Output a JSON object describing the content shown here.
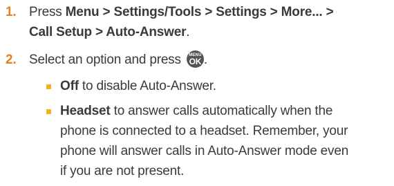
{
  "steps": [
    {
      "number": "1.",
      "line1_bold": "Menu > Settings/Tools > Settings > More... >",
      "line1_prefix": "Press ",
      "line2_bold": "Call Setup > Auto-Answer",
      "line2_suffix": "."
    },
    {
      "number": "2.",
      "text": "Select an option and press ",
      "key_icon": "menu-ok-key-icon",
      "key_label_top": "MENU",
      "key_label_bottom": "OK",
      "suffix": "."
    }
  ],
  "options": [
    {
      "bold": "Off",
      "lines": [
        " to disable Auto-Answer."
      ]
    },
    {
      "bold": "Headset",
      "lines": [
        " to answer calls automatically when the",
        "phone is connected to a headset. Remember, your",
        "phone will answer calls in Auto-Answer mode even",
        "if you are not present."
      ]
    }
  ],
  "colors": {
    "step_number": "#e87f22",
    "bullet": "#f2b21b",
    "text": "#3a3a3a",
    "key": "#545454"
  }
}
